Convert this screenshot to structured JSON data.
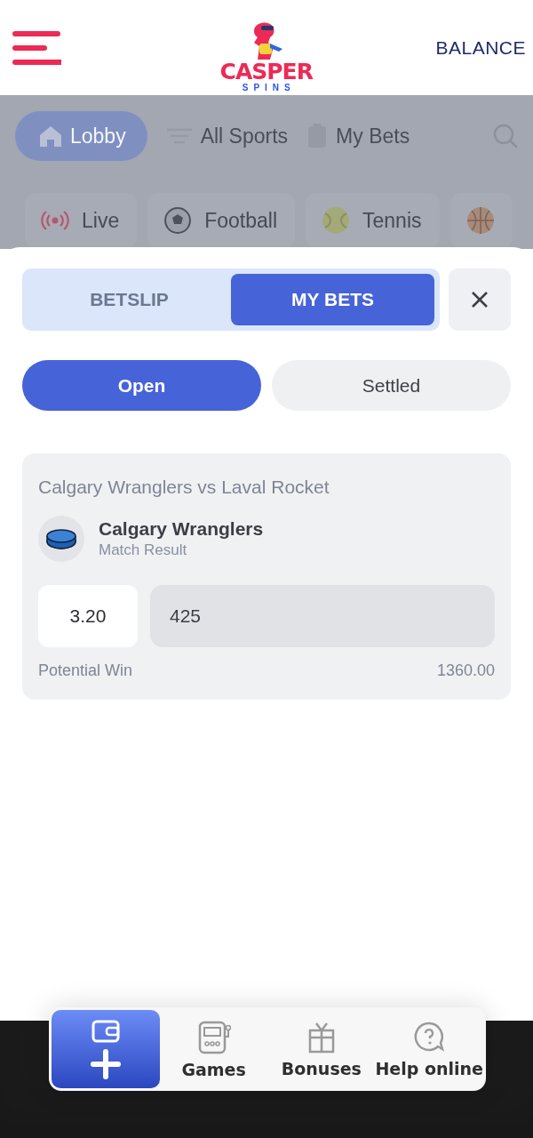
{
  "header": {
    "balance": "BALANCE",
    "logo": {
      "name": "CASPER",
      "sub": "SPINS"
    }
  },
  "background_nav": {
    "tabs": [
      {
        "label": "Lobby",
        "kind": "home",
        "selected": true
      },
      {
        "label": "All Sports",
        "kind": "list",
        "selected": false
      },
      {
        "label": "My Bets",
        "kind": "clipboard",
        "selected": false
      }
    ],
    "sports": [
      {
        "label": "Live",
        "kind": "live"
      },
      {
        "label": "Football",
        "kind": "football"
      },
      {
        "label": "Tennis",
        "kind": "tennis"
      },
      {
        "kind": "basketball"
      }
    ]
  },
  "sheet": {
    "tabs": [
      {
        "label": "BETSLIP",
        "selected": false
      },
      {
        "label": "MY BETS",
        "selected": true
      }
    ],
    "filters": [
      {
        "label": "Open",
        "selected": true
      },
      {
        "label": "Settled",
        "selected": false
      }
    ],
    "bets": [
      {
        "match": "Calgary Wranglers vs Laval Rocket",
        "selection": "Calgary Wranglers",
        "market": "Match Result",
        "odds": "3.20",
        "stake": "425",
        "win_label": "Potential Win",
        "win_value": "1360.00"
      }
    ]
  },
  "bottom_nav": [
    {
      "kind": "deposit",
      "selected": true
    },
    {
      "kind": "games",
      "label": "Games",
      "selected": false
    },
    {
      "kind": "bonuses",
      "label": "Bonuses",
      "selected": false
    },
    {
      "kind": "help",
      "label": "Help online",
      "selected": false
    }
  ]
}
